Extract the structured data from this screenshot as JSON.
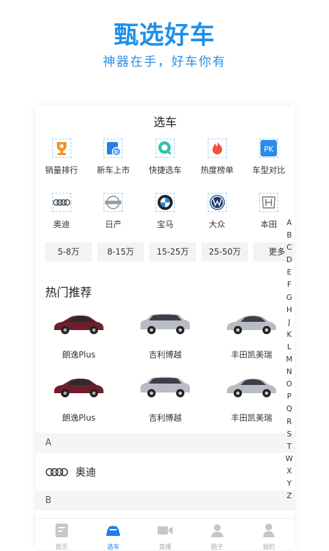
{
  "promo": {
    "headline": "甄选好车",
    "tagline": "神器在手，好车你有"
  },
  "card": {
    "title": "选车"
  },
  "quick_entries": [
    {
      "label": "销量排行",
      "icon": "trophy-icon"
    },
    {
      "label": "新车上市",
      "icon": "new-car-icon"
    },
    {
      "label": "快捷选车",
      "icon": "search-icon"
    },
    {
      "label": "热度榜单",
      "icon": "flame-icon"
    },
    {
      "label": "车型对比",
      "icon": "pk-icon"
    }
  ],
  "brands": [
    {
      "label": "奥迪",
      "icon": "audi-logo"
    },
    {
      "label": "日产",
      "icon": "nissan-logo"
    },
    {
      "label": "宝马",
      "icon": "bmw-logo"
    },
    {
      "label": "大众",
      "icon": "vw-logo"
    },
    {
      "label": "本田",
      "icon": "honda-logo"
    }
  ],
  "price_filters": [
    "5-8万",
    "8-15万",
    "15-25万",
    "25-50万",
    "更多"
  ],
  "hot": {
    "title": "热门推荐",
    "cars": [
      "朗逸Plus",
      "吉利博越",
      "丰田凯美瑞",
      "朗逸Plus",
      "吉利博越",
      "丰田凯美瑞"
    ]
  },
  "brand_list": {
    "groups": [
      {
        "letter": "A",
        "brands": [
          "奥迪"
        ]
      },
      {
        "letter": "B",
        "brands": []
      }
    ]
  },
  "index_letters": [
    "A",
    "B",
    "C",
    "D",
    "E",
    "F",
    "G",
    "H",
    "J",
    "K",
    "L",
    "M",
    "N",
    "O",
    "P",
    "Q",
    "R",
    "S",
    "T",
    "W",
    "X",
    "Y",
    "Z"
  ],
  "tabbar": {
    "tabs": [
      {
        "label": "首页",
        "icon": "home-icon",
        "active": false
      },
      {
        "label": "选车",
        "icon": "car-icon",
        "active": true
      },
      {
        "label": "直播",
        "icon": "video-icon",
        "active": false
      },
      {
        "label": "圈子",
        "icon": "community-icon",
        "active": false
      },
      {
        "label": "我的",
        "icon": "profile-icon",
        "active": false
      }
    ]
  },
  "colors": {
    "accent": "#1e90ea",
    "tab_active": "#1e80e8",
    "car_red": "#6e1f2b",
    "car_silver": "#b9bdc3"
  }
}
